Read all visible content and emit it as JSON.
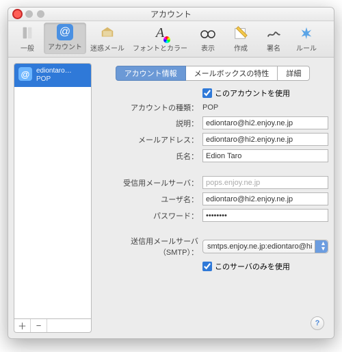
{
  "window": {
    "title": "アカウント"
  },
  "toolbar": {
    "items": [
      {
        "label": "一般",
        "icon": "⎘"
      },
      {
        "label": "アカウント",
        "icon": "@"
      },
      {
        "label": "迷惑メール",
        "icon": "⊘"
      },
      {
        "label": "フォントとカラー",
        "icon": "A"
      },
      {
        "label": "表示",
        "icon": "👓"
      },
      {
        "label": "作成",
        "icon": "✎"
      },
      {
        "label": "署名",
        "icon": "Sig"
      },
      {
        "label": "ルール",
        "icon": "✶"
      }
    ]
  },
  "sidebar": {
    "account": {
      "name": "ediontaro…",
      "type": "POP",
      "badge": "@"
    },
    "buttons": {
      "add": "＋",
      "remove": "−"
    }
  },
  "tabs": {
    "info": "アカウント情報",
    "mailbox": "メールボックスの特性",
    "advanced": "詳細"
  },
  "form": {
    "enable_label": "このアカウントを使用",
    "type_label": "アカウントの種類：",
    "type_value": "POP",
    "desc_label": "説明：",
    "desc_value": "ediontaro@hi2.enjoy.ne.jp",
    "email_label": "メールアドレス：",
    "email_value": "ediontaro@hi2.enjoy.ne.jp",
    "fullname_label": "氏名：",
    "fullname_value": "Edion Taro",
    "incoming_label": "受信用メールサーバ：",
    "incoming_value": "pops.enjoy.ne.jp",
    "user_label": "ユーザ名：",
    "user_value": "ediontaro@hi2.enjoy.ne.jp",
    "password_label": "パスワード：",
    "password_value": "••••••••",
    "smtp_label": "送信用メールサーバ（SMTP）：",
    "smtp_value": "smtps.enjoy.ne.jp:ediontaro@hi",
    "smtp_only_label": "このサーバのみを使用"
  },
  "help": "?"
}
